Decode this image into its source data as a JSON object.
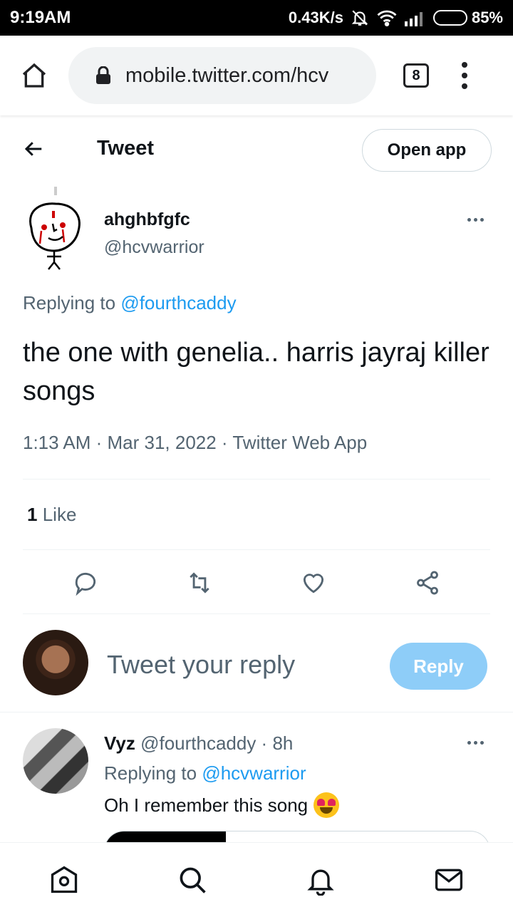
{
  "status_bar": {
    "time": "9:19AM",
    "net_speed": "0.43K/s",
    "battery_pct": "85%",
    "battery_level": 0.85
  },
  "browser": {
    "url": "mobile.twitter.com/hcv",
    "tab_count": "8"
  },
  "header": {
    "title": "Tweet",
    "open_app_label": "Open app"
  },
  "tweet": {
    "author_name": "ahghbfgfc",
    "author_handle": "@hcvwarrior",
    "replying_prefix": "Replying to",
    "replying_to": "@fourthcaddy",
    "text": "the one with genelia.. harris jayraj killer songs",
    "meta": "1:13 AM · Mar 31, 2022 · Twitter Web App",
    "like_count": "1",
    "like_label": "Like"
  },
  "composer": {
    "placeholder": "Tweet your reply",
    "reply_label": "Reply"
  },
  "reply": {
    "name": "Vyz",
    "handle_time": "@fourthcaddy · 8h",
    "replying_prefix": "Replying to",
    "replying_to": "@hcvwarrior",
    "text": "Oh I remember this song"
  },
  "colors": {
    "accent": "#1d9bf0",
    "reply_button_disabled": "#8ecdf8",
    "secondary_text": "#536471"
  },
  "icons": {
    "browser_home": "home-icon",
    "lock": "lock-icon",
    "back": "arrow-left-icon",
    "reply": "reply-bubble-icon",
    "retweet": "retweet-icon",
    "like": "heart-icon",
    "share": "share-icon",
    "nav_home": "home-icon",
    "nav_search": "search-icon",
    "nav_notifications": "bell-icon",
    "nav_messages": "mail-icon"
  }
}
